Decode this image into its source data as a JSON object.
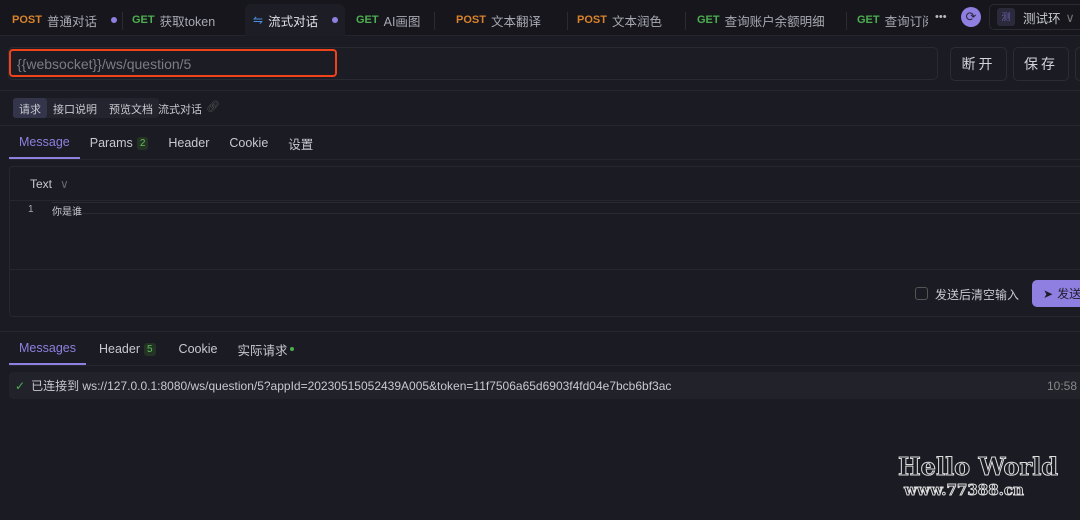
{
  "tabs": [
    {
      "method": "POST",
      "label": "普通对话",
      "dirty": true
    },
    {
      "method": "GET",
      "label": "获取token"
    },
    {
      "method": "WS",
      "label": "流式对话",
      "dirty": true,
      "active": true
    },
    {
      "method": "GET",
      "label": "AI画图"
    },
    {
      "method": "POST",
      "label": "文本翻译"
    },
    {
      "method": "POST",
      "label": "文本润色"
    },
    {
      "method": "GET",
      "label": "查询账户余额明细"
    },
    {
      "method": "GET",
      "label": "查询订阅"
    }
  ],
  "more": "•••",
  "env": {
    "avatar": "测",
    "label": "测试环"
  },
  "url": "{{websocket}}/ws/question/5",
  "buttons": {
    "disconnect": "断开",
    "save": "保存"
  },
  "segments": [
    "请求",
    "接口说明",
    "预览文档"
  ],
  "api_name": "流式对话",
  "req_tabs": [
    {
      "label": "Message"
    },
    {
      "label": "Params",
      "badge": "2"
    },
    {
      "label": "Header"
    },
    {
      "label": "Cookie"
    },
    {
      "label": "设置"
    }
  ],
  "body_type": "Text",
  "editor": {
    "line": "1",
    "text": "你是谁"
  },
  "clear_after_send": "发送后清空输入",
  "send": "发送",
  "resp_tabs": [
    {
      "label": "Messages"
    },
    {
      "label": "Header",
      "badge": "5"
    },
    {
      "label": "Cookie"
    },
    {
      "label": "实际请求"
    }
  ],
  "message": {
    "status": "已连接到",
    "text": "ws://127.0.0.1:8080/ws/question/5?appId=20230515052439A005&token=11f7506a65d6903f4fd04e7bcb6bf3ac",
    "time": "10:58"
  },
  "watermark": {
    "line1": "Hello World",
    "line2": "www.77388.cn"
  },
  "colors": {
    "accent": "#8f7fe0",
    "post": "#d9822b",
    "get": "#4caf50",
    "highlight": "#f0431c"
  }
}
